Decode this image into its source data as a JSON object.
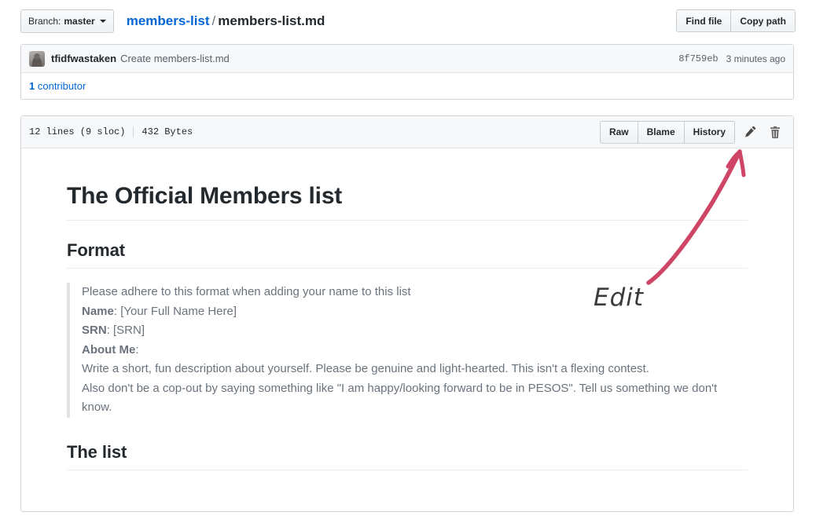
{
  "toolbar": {
    "branch_label": "Branch:",
    "branch_name": "master",
    "breadcrumb_repo": "members-list",
    "breadcrumb_separator": "/",
    "breadcrumb_file": "members-list.md",
    "find_file_label": "Find file",
    "copy_path_label": "Copy path"
  },
  "commit": {
    "author": "tfidfwastaken",
    "message": "Create members-list.md",
    "sha": "8f759eb",
    "time": "3 minutes ago",
    "contributors_count": "1",
    "contributors_label": "contributor"
  },
  "file": {
    "lines": "12 lines (9 sloc)",
    "size": "432 Bytes",
    "raw_label": "Raw",
    "blame_label": "Blame",
    "history_label": "History",
    "edit_icon_name": "pencil-icon",
    "delete_icon_name": "trash-icon"
  },
  "content": {
    "title": "The Official Members list",
    "format_heading": "Format",
    "quote": {
      "line1": "Please adhere to this format when adding your name to this list",
      "name_label": "Name",
      "name_value": ": [Your Full Name Here]",
      "srn_label": "SRN",
      "srn_value": ": [SRN]",
      "about_label": "About Me",
      "about_value": ":",
      "body1": "Write a short, fun description about yourself. Please be genuine and light-hearted. This isn't a flexing contest.",
      "body2": "Also don't be a cop-out by saying something like \"I am happy/looking forward to be in PESOS\". Tell us something we don't know."
    },
    "list_heading": "The list"
  },
  "annotation": {
    "label": "Edit",
    "arrow_color": "#cf4566",
    "label_color": "#3b3b3b"
  },
  "colors": {
    "link": "#0366d6",
    "text": "#24292e",
    "muted": "#586069",
    "border": "#d1d5da",
    "header_bg": "#f6f8fa"
  }
}
